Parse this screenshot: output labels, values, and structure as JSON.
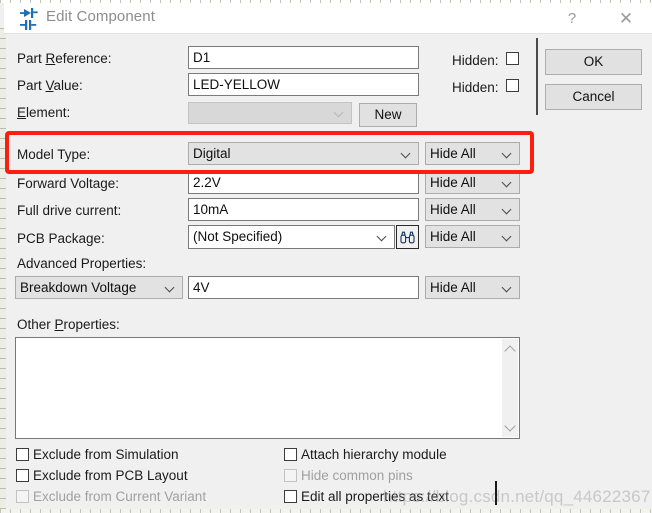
{
  "window": {
    "title": "Edit Component",
    "icon": "component-diode-icon",
    "help_label": "?",
    "close_label": "✕"
  },
  "form": {
    "part_reference": {
      "label_pre": "Part ",
      "label_mnemonic": "R",
      "label_post": "eference:",
      "value": "D1",
      "hidden_label": "Hidden:"
    },
    "part_value": {
      "label_pre": "Part ",
      "label_mnemonic": "V",
      "label_post": "alue:",
      "value": "LED-YELLOW",
      "hidden_label": "Hidden:"
    },
    "element": {
      "label_pre": "",
      "label_mnemonic": "E",
      "label_post": "lement:",
      "value": "",
      "new_button": "New"
    },
    "model_type": {
      "label": "Model Type:",
      "value": "Digital",
      "visibility": "Hide All"
    },
    "forward_voltage": {
      "label": "Forward Voltage:",
      "value": "2.2V",
      "visibility": "Hide All"
    },
    "full_drive_current": {
      "label": "Full drive current:",
      "value": "10mA",
      "visibility": "Hide All"
    },
    "pcb_package": {
      "label": "PCB Package:",
      "value": "(Not Specified)",
      "visibility": "Hide All",
      "browse_icon": "binoculars-icon"
    },
    "advanced_properties": {
      "label": "Advanced Properties:",
      "property": "Breakdown Voltage",
      "value": "4V",
      "visibility": "Hide All"
    },
    "other_properties": {
      "label_pre": "Other ",
      "label_mnemonic": "P",
      "label_post": "roperties:",
      "value": ""
    }
  },
  "checkboxes": {
    "left": [
      {
        "label": "Exclude from Simulation",
        "checked": false,
        "disabled": false
      },
      {
        "label": "Exclude from PCB Layout",
        "checked": false,
        "disabled": false
      },
      {
        "label": "Exclude from Current Variant",
        "checked": false,
        "disabled": true
      }
    ],
    "right": [
      {
        "label": "Attach hierarchy module",
        "checked": false,
        "disabled": false
      },
      {
        "label": "Hide common pins",
        "checked": false,
        "disabled": true
      },
      {
        "label": "Edit all properties as text",
        "checked": false,
        "disabled": false
      }
    ]
  },
  "buttons": {
    "ok": "OK",
    "cancel": "Cancel"
  },
  "annotation": {
    "highlight_color": "#fc1f10",
    "highlight_target": "model-type-row"
  },
  "watermark": {
    "text": "https://blog.csdn.net/qq_44622367"
  }
}
